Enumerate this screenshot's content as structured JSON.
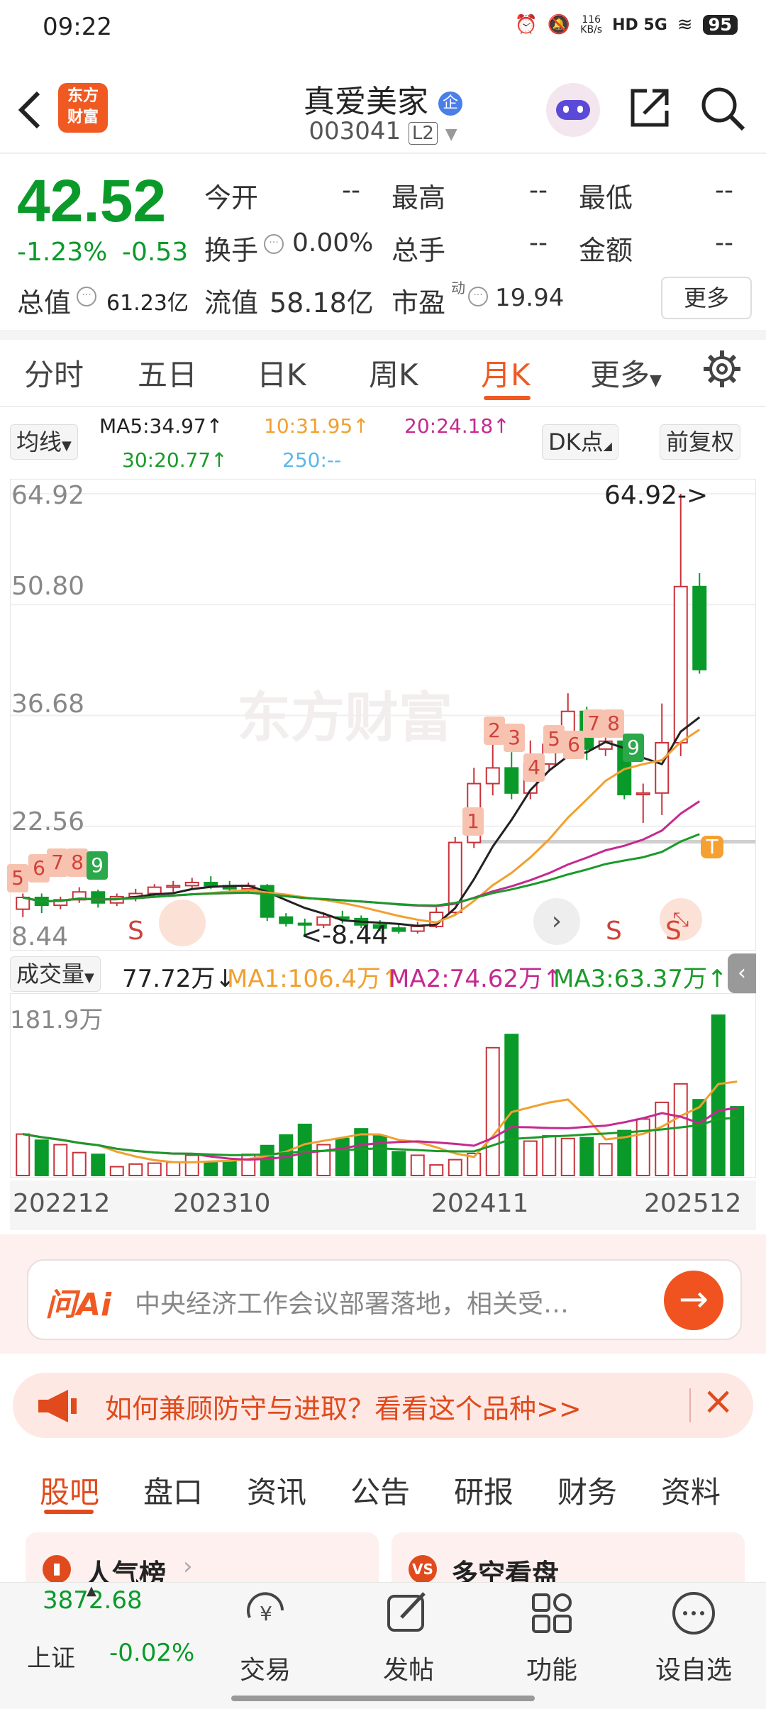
{
  "status_bar": {
    "time": "09:22",
    "speed": "116\nKB/s",
    "net": "HD 5G",
    "battery": "95"
  },
  "header": {
    "logo_text": "东方\n财富",
    "title": "真爱美家",
    "badge": "企",
    "code": "003041",
    "level": "L2"
  },
  "quote": {
    "price": "42.52",
    "change_pct": "-1.23%",
    "change_val": "-0.53",
    "fields": [
      {
        "label": "今开",
        "value": "--"
      },
      {
        "label": "最高",
        "value": "--"
      },
      {
        "label": "最低",
        "value": "--"
      },
      {
        "label": "换手",
        "value": "0.00%"
      },
      {
        "label": "总手",
        "value": "--"
      },
      {
        "label": "金额",
        "value": "--"
      }
    ],
    "total_cap_label": "总值",
    "total_cap": "61.23亿",
    "float_cap_label": "流值",
    "float_cap": "58.18亿",
    "pe_label": "市盈",
    "pe_sup": "动",
    "pe": "19.94",
    "more_label": "更多"
  },
  "ktabs": [
    "分时",
    "五日",
    "日K",
    "周K",
    "月K",
    "更多"
  ],
  "ktab_active": "月K",
  "ma_bar": {
    "select": "均线",
    "ma5": "MA5:34.97↑",
    "ma10": "10:31.95↑",
    "ma20": "20:24.18↑",
    "ma30": "30:20.77↑",
    "ma250": "250:--",
    "dk": "DK点",
    "fq": "前复权"
  },
  "chart": {
    "y_labels": [
      "64.92",
      "50.80",
      "36.68",
      "22.56",
      "8.44"
    ],
    "max_label": "64.92->",
    "min_label": "<-8.44",
    "watermark": "东方财富",
    "sell_marks": [
      "S",
      "S",
      "S"
    ],
    "count_marks": [
      "5",
      "6",
      "7",
      "8",
      "9",
      "1",
      "2",
      "3",
      "4",
      "5",
      "6",
      "7",
      "8",
      "9"
    ],
    "t_mark": "T"
  },
  "chart_data": {
    "type": "candlestick",
    "period": "monthly",
    "ylim": [
      8.44,
      64.92
    ],
    "candles": [
      {
        "o": 12.0,
        "c": 13.5,
        "h": 14.0,
        "l": 11.0
      },
      {
        "o": 13.5,
        "c": 12.5,
        "h": 14.0,
        "l": 11.5
      },
      {
        "o": 12.5,
        "c": 13.2,
        "h": 13.6,
        "l": 12.0
      },
      {
        "o": 13.2,
        "c": 14.2,
        "h": 14.8,
        "l": 12.8
      },
      {
        "o": 14.2,
        "c": 12.8,
        "h": 14.5,
        "l": 12.2
      },
      {
        "o": 12.8,
        "c": 13.6,
        "h": 14.0,
        "l": 12.4
      },
      {
        "o": 13.6,
        "c": 14.0,
        "h": 14.6,
        "l": 13.0
      },
      {
        "o": 14.0,
        "c": 14.8,
        "h": 15.2,
        "l": 13.6
      },
      {
        "o": 14.8,
        "c": 15.0,
        "h": 15.6,
        "l": 14.2
      },
      {
        "o": 15.0,
        "c": 15.4,
        "h": 16.0,
        "l": 14.5
      },
      {
        "o": 15.4,
        "c": 15.0,
        "h": 16.2,
        "l": 14.6
      },
      {
        "o": 15.0,
        "c": 14.6,
        "h": 15.6,
        "l": 14.0
      },
      {
        "o": 14.6,
        "c": 15.0,
        "h": 15.4,
        "l": 14.2
      },
      {
        "o": 15.0,
        "c": 11.0,
        "h": 15.2,
        "l": 10.5
      },
      {
        "o": 11.0,
        "c": 10.2,
        "h": 11.5,
        "l": 9.8
      },
      {
        "o": 10.2,
        "c": 10.0,
        "h": 10.8,
        "l": 8.44
      },
      {
        "o": 10.0,
        "c": 11.0,
        "h": 11.6,
        "l": 9.6
      },
      {
        "o": 11.0,
        "c": 10.8,
        "h": 11.8,
        "l": 10.2
      },
      {
        "o": 10.8,
        "c": 10.0,
        "h": 11.2,
        "l": 9.6
      },
      {
        "o": 10.0,
        "c": 9.6,
        "h": 10.6,
        "l": 9.2
      },
      {
        "o": 9.6,
        "c": 9.2,
        "h": 10.2,
        "l": 8.9
      },
      {
        "o": 9.2,
        "c": 9.8,
        "h": 10.4,
        "l": 8.9
      },
      {
        "o": 9.8,
        "c": 11.6,
        "h": 12.2,
        "l": 9.6
      },
      {
        "o": 11.6,
        "c": 20.5,
        "h": 21.2,
        "l": 11.2
      },
      {
        "o": 20.5,
        "c": 28.0,
        "h": 30.0,
        "l": 19.8
      },
      {
        "o": 28.0,
        "c": 30.0,
        "h": 35.5,
        "l": 26.5
      },
      {
        "o": 30.0,
        "c": 26.8,
        "h": 32.0,
        "l": 26.0
      },
      {
        "o": 26.8,
        "c": 30.5,
        "h": 33.5,
        "l": 26.0
      },
      {
        "o": 30.5,
        "c": 33.0,
        "h": 35.0,
        "l": 29.5
      },
      {
        "o": 33.0,
        "c": 37.2,
        "h": 39.5,
        "l": 32.0
      },
      {
        "o": 37.2,
        "c": 32.4,
        "h": 37.8,
        "l": 31.0
      },
      {
        "o": 32.4,
        "c": 33.4,
        "h": 34.5,
        "l": 31.5
      },
      {
        "o": 33.4,
        "c": 26.6,
        "h": 34.0,
        "l": 26.0
      },
      {
        "o": 26.6,
        "c": 26.8,
        "h": 28.0,
        "l": 23.0
      },
      {
        "o": 26.8,
        "c": 33.2,
        "h": 38.2,
        "l": 24.0
      },
      {
        "o": 33.2,
        "c": 53.1,
        "h": 64.92,
        "l": 31.5
      },
      {
        "o": 53.1,
        "c": 42.52,
        "h": 54.8,
        "l": 42.0
      }
    ],
    "volume_label": "成交量",
    "volume_current": "77.72万↓",
    "vol_ma1": "MA1:106.4万↑",
    "vol_ma2": "MA2:74.62万↑",
    "vol_ma3": "MA3:63.37万↑",
    "volume_max_label": "181.9万",
    "volume_max": 181.9,
    "volumes": [
      47,
      40,
      35,
      26,
      24,
      10,
      13,
      14,
      15,
      23,
      15,
      16,
      24,
      34,
      46,
      58,
      35,
      42,
      53,
      45,
      27,
      23,
      12,
      18,
      25,
      145,
      160,
      39,
      45,
      42,
      43,
      36,
      51,
      64,
      83,
      104,
      86,
      181.9,
      78
    ],
    "x_labels": [
      "202212",
      "202310",
      "202411",
      "202512"
    ]
  },
  "ai": {
    "prefix": "问Ai",
    "text": "中央经济工作会议部署落地，相关受…"
  },
  "promo": {
    "text": "如何兼顾防守与进取？看看这个品种>>"
  },
  "bottom_tabs": [
    "股吧",
    "盘口",
    "资讯",
    "公告",
    "研报",
    "财务",
    "资料"
  ],
  "bottom_active": "股吧",
  "cards": [
    {
      "label": "人气榜"
    },
    {
      "label": "多空看盘"
    }
  ],
  "index": {
    "value": "3872.68",
    "name": "上证",
    "change": "-0.02%"
  },
  "nav": [
    "交易",
    "发帖",
    "功能",
    "设自选"
  ],
  "colors": {
    "up": "#c8323a",
    "down": "#0a9a2a",
    "accent": "#f05a22",
    "ma5": "#222222",
    "ma10": "#f0a030",
    "ma20": "#c42a8f",
    "ma30": "#1a9a2a",
    "ma250": "#5ab8e8"
  }
}
